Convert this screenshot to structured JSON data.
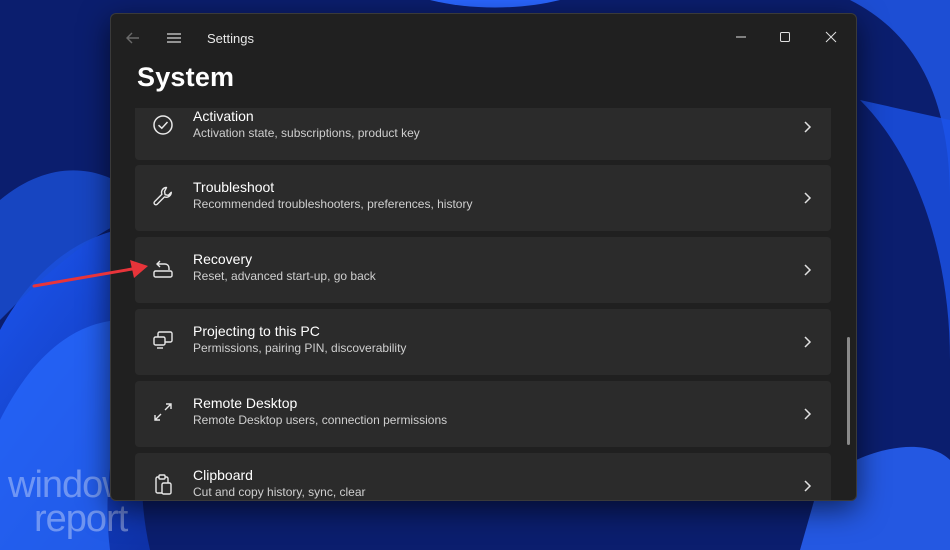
{
  "window": {
    "app_title": "Settings",
    "page_title": "System"
  },
  "settings_items": [
    {
      "title": "Activation",
      "description": "Activation state, subscriptions, product key",
      "icon": "check-circle-icon"
    },
    {
      "title": "Troubleshoot",
      "description": "Recommended troubleshooters, preferences, history",
      "icon": "wrench-icon"
    },
    {
      "title": "Recovery",
      "description": "Reset, advanced start-up, go back",
      "icon": "recovery-icon"
    },
    {
      "title": "Projecting to this PC",
      "description": "Permissions, pairing PIN, discoverability",
      "icon": "projecting-icon"
    },
    {
      "title": "Remote Desktop",
      "description": "Remote Desktop users, connection permissions",
      "icon": "remote-desktop-icon"
    },
    {
      "title": "Clipboard",
      "description": "Cut and copy history, sync, clear",
      "icon": "clipboard-icon"
    }
  ],
  "watermark": {
    "line1": "windows",
    "line2": "report"
  },
  "colors": {
    "window_bg": "#202020",
    "card_bg": "#2b2b2b",
    "annotation_arrow": "#e8343a"
  }
}
